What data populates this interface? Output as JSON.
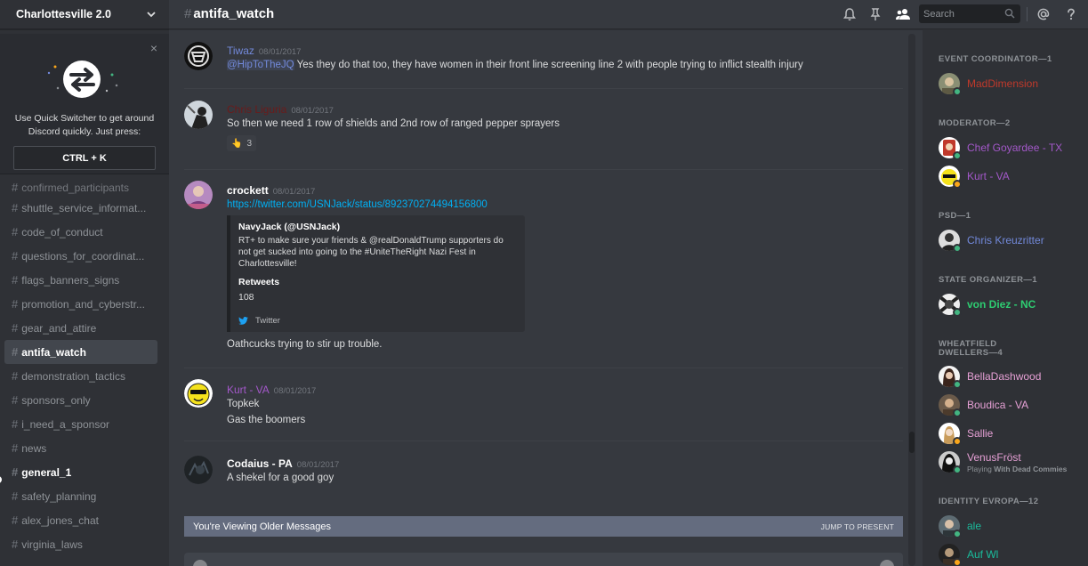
{
  "server": {
    "name": "Charlottesville 2.0"
  },
  "quick_switcher": {
    "line1": "Use Quick Switcher to get around",
    "line2": "Discord quickly. Just press:",
    "shortcut": "CTRL + K"
  },
  "channels": [
    {
      "name": "confirmed_participants"
    },
    {
      "name": "shuttle_service_informat..."
    },
    {
      "name": "code_of_conduct"
    },
    {
      "name": "questions_for_coordinat..."
    },
    {
      "name": "flags_banners_signs"
    },
    {
      "name": "promotion_and_cyberstr..."
    },
    {
      "name": "gear_and_attire"
    },
    {
      "name": "antifa_watch"
    },
    {
      "name": "demonstration_tactics"
    },
    {
      "name": "sponsors_only"
    },
    {
      "name": "i_need_a_sponsor"
    },
    {
      "name": "news"
    },
    {
      "name": "general_1"
    },
    {
      "name": "safety_planning"
    },
    {
      "name": "alex_jones_chat"
    },
    {
      "name": "virginia_laws"
    }
  ],
  "header": {
    "channel": "antifa_watch",
    "search_placeholder": "Search"
  },
  "colors": {
    "background": "#36393f",
    "sidebar": "#2f3136",
    "mention": "#7289da",
    "link": "#00b0f4",
    "online": "#43b581",
    "idle": "#faa61a"
  },
  "messages": [
    {
      "author": "Tiwaz",
      "timestamp": "08/01/2017",
      "color": "#7289da",
      "mention": "@HipToTheJQ",
      "text": " Yes they do that too, they have women in their front line screening line 2 with people trying to inflict stealth injury"
    },
    {
      "author": "Chris Liguria",
      "timestamp": "08/01/2017",
      "color": "#6b1a1a",
      "text": "So then we need 1 row of shields and 2nd row of ranged pepper sprayers",
      "reaction": {
        "emoji": "👆",
        "count": "3"
      }
    },
    {
      "author": "crockett",
      "timestamp": "08/01/2017",
      "link": "https://twitter.com/USNJack/status/892370274494156800",
      "embed": {
        "author": "NavyJack (@USNJack)",
        "description": "RT+ to make sure your friends & @realDonaldTrump supporters do not get sucked into going to the #UniteTheRight Nazi Fest in Charlottesville!",
        "field_name": "Retweets",
        "field_value": "108",
        "footer": "Twitter"
      },
      "text": "Oathcucks trying to stir up trouble."
    },
    {
      "author": "Kurt - VA",
      "timestamp": "08/01/2017",
      "color": "#a358c9",
      "line1": "Topkek",
      "line2": "Gas the boomers"
    },
    {
      "author": "Codaius - PA",
      "timestamp": "08/01/2017",
      "text": "A shekel for a good goy"
    }
  ],
  "older_bar": {
    "text": "You're Viewing Older Messages",
    "jump": "JUMP TO PRESENT"
  },
  "members": {
    "groups": [
      {
        "title": "EVENT COORDINATOR—1"
      },
      {
        "title": "MODERATOR—2"
      },
      {
        "title": "PSD—1"
      },
      {
        "title": "STATE ORGANIZER—1"
      },
      {
        "title_line1": "WHEATFIELD",
        "title_line2": "DWELLERS—4"
      },
      {
        "title": "IDENTITY EVROPA—12"
      }
    ],
    "list": [
      {
        "name": "MadDimension",
        "color": "#c0392b"
      },
      {
        "name": "Chef Goyardee - TX",
        "color": "#a358c9"
      },
      {
        "name": "Kurt - VA",
        "color": "#a358c9"
      },
      {
        "name": "Chris Kreuzritter",
        "color": "#7289da"
      },
      {
        "name": "von Diez - NC",
        "color": "#2ecc71"
      },
      {
        "name": "BellaDashwood",
        "color": "#e6a0d5"
      },
      {
        "name": "Boudica - VA",
        "color": "#e6a0d5"
      },
      {
        "name": "Sallie",
        "color": "#e6a0d5"
      },
      {
        "name": "VenusFröst",
        "color": "#e6a0d5",
        "activity_prefix": "Playing ",
        "activity": "With Dead Commies"
      },
      {
        "name": "ale",
        "color": "#1abc9c"
      },
      {
        "name": "Auf Wl",
        "color": "#1abc9c"
      }
    ]
  }
}
